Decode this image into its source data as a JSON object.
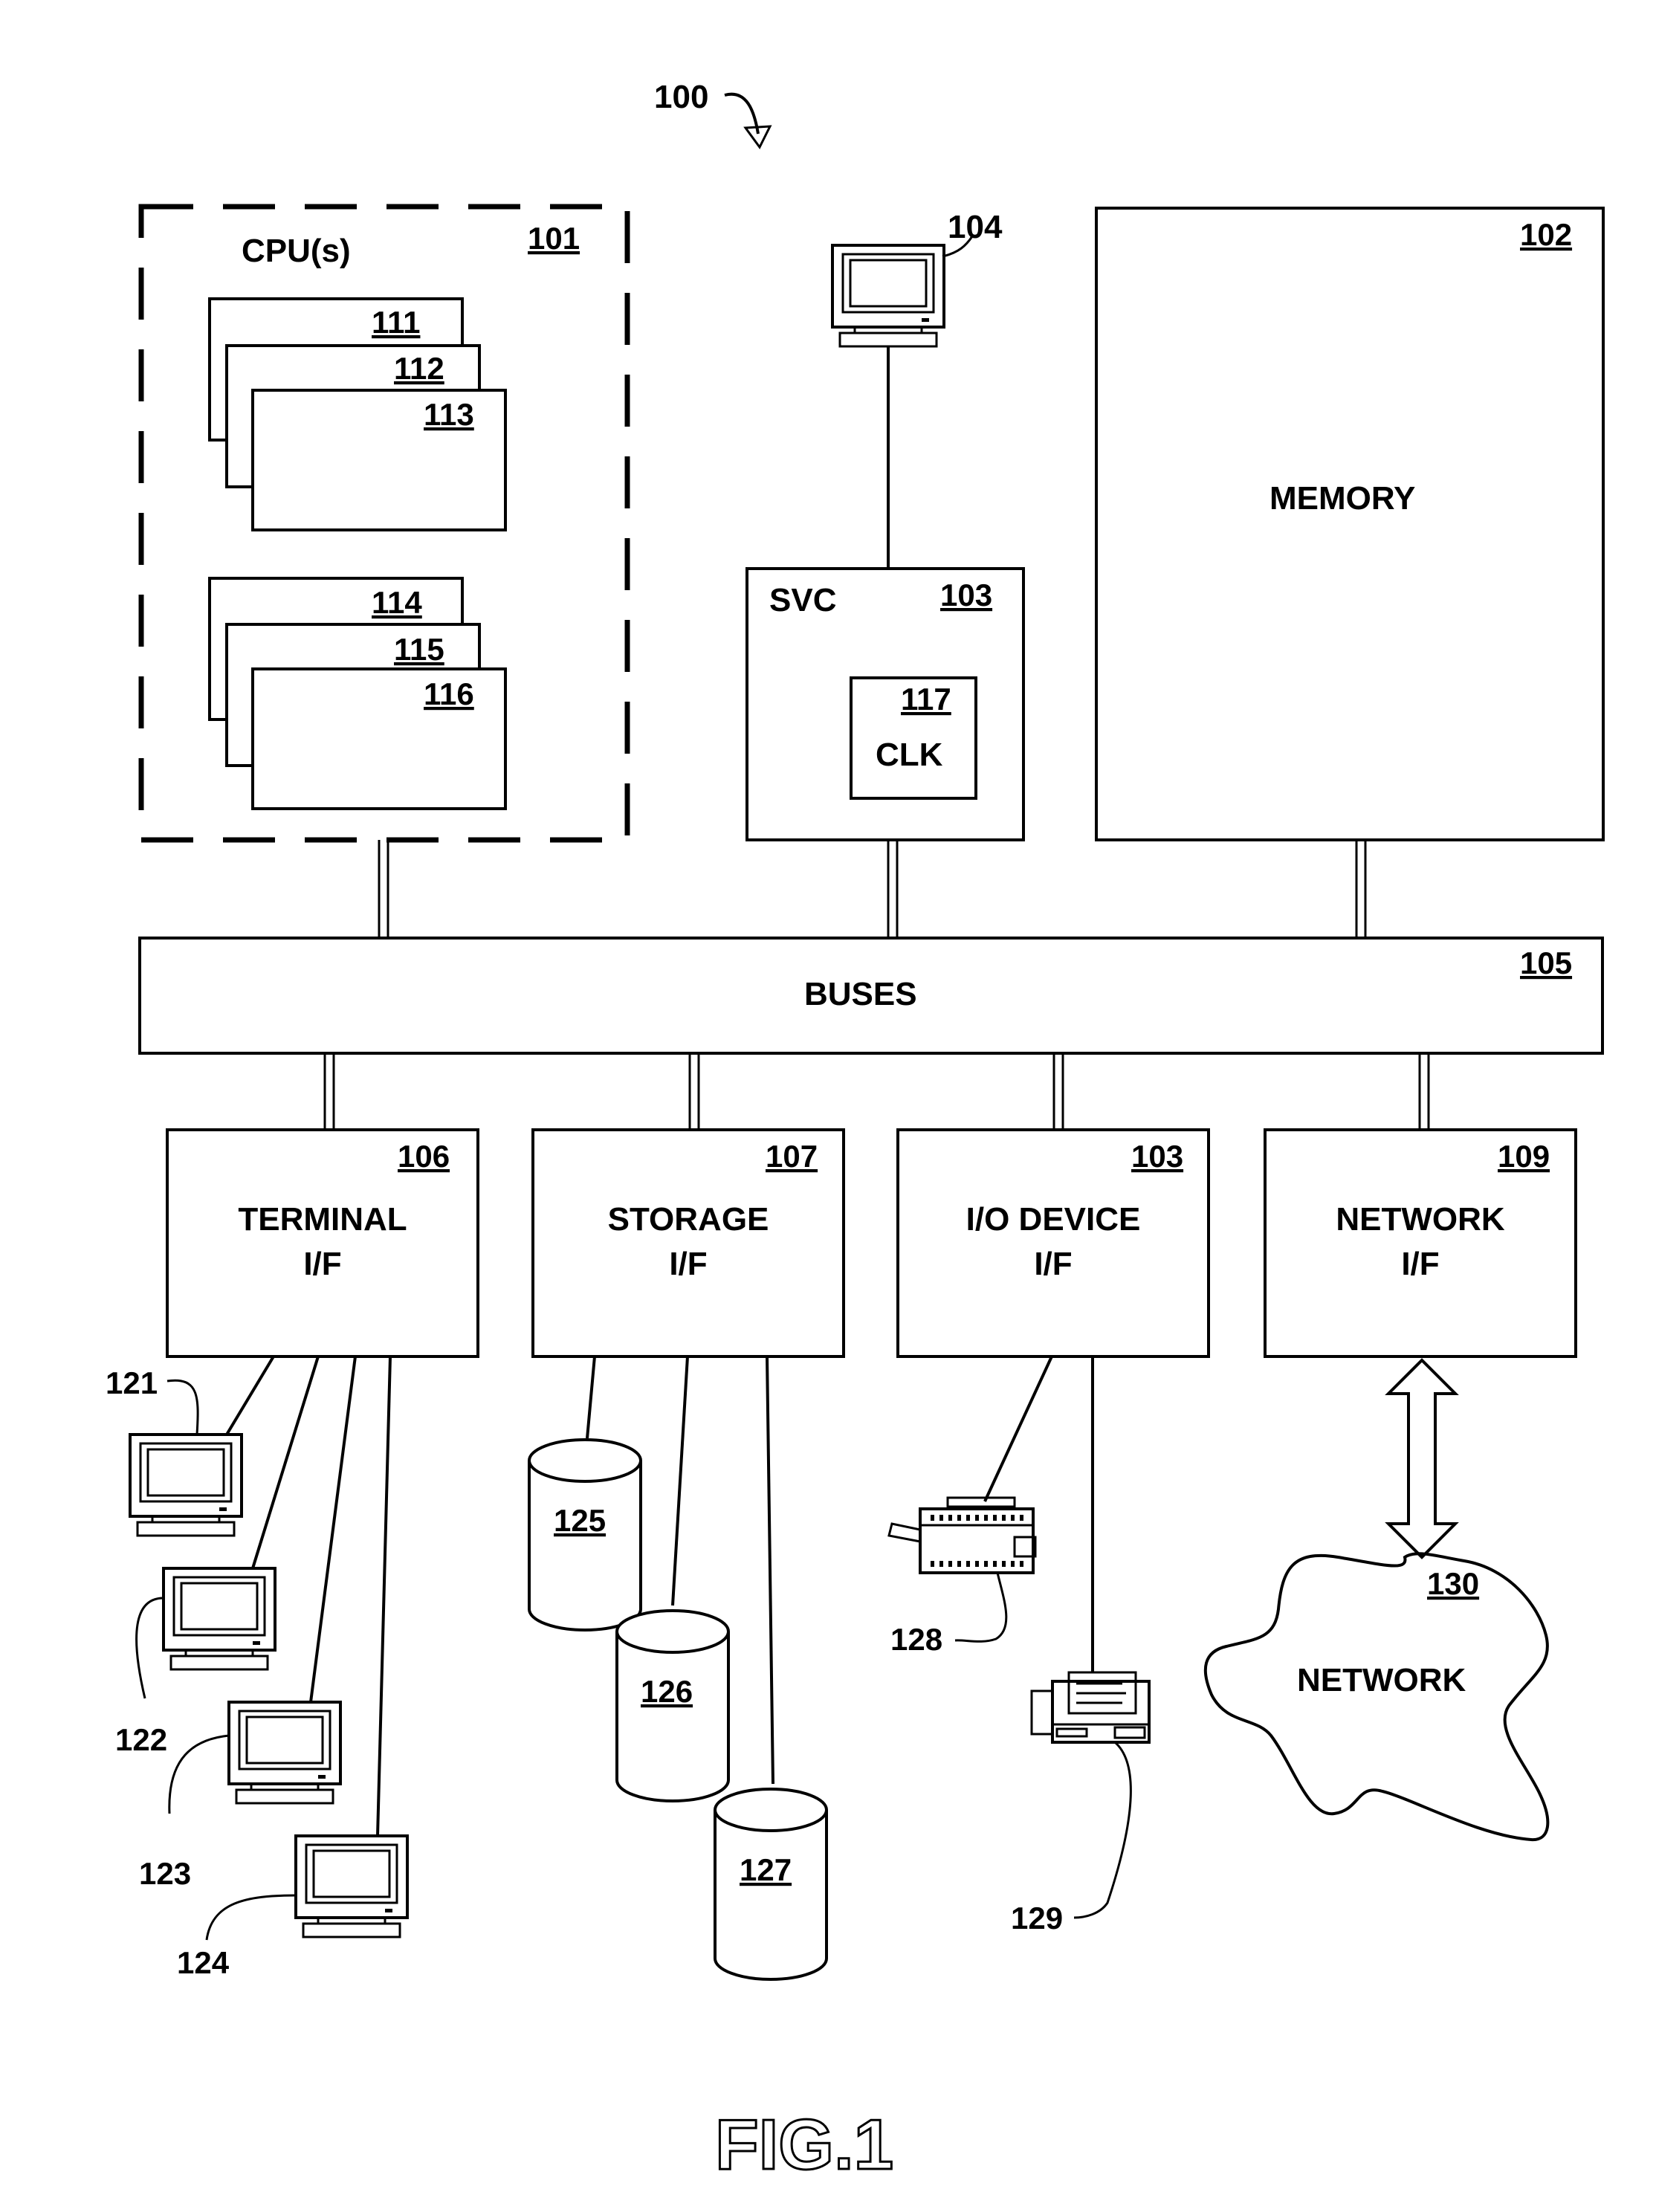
{
  "figure": {
    "ref": "100",
    "caption": "FIG.1"
  },
  "cpu": {
    "title": "CPU(s)",
    "ref": "101",
    "processors_group_a": [
      "111",
      "112",
      "113"
    ],
    "processors_group_b": [
      "114",
      "115",
      "116"
    ]
  },
  "console": {
    "ref": "104"
  },
  "svc": {
    "title": "SVC",
    "ref": "103",
    "clock": {
      "ref": "117",
      "title": "CLK"
    }
  },
  "memory": {
    "title": "MEMORY",
    "ref": "102"
  },
  "buses": {
    "title": "BUSES",
    "ref": "105"
  },
  "interfaces": [
    {
      "ref": "106",
      "line1": "TERMINAL",
      "line2": "I/F"
    },
    {
      "ref": "107",
      "line1": "STORAGE",
      "line2": "I/F"
    },
    {
      "ref": "103",
      "line1": "I/O DEVICE",
      "line2": "I/F"
    },
    {
      "ref": "109",
      "line1": "NETWORK",
      "line2": "I/F"
    }
  ],
  "terminals": [
    "121",
    "122",
    "123",
    "124"
  ],
  "storage_devices": [
    "125",
    "126",
    "127"
  ],
  "printer": {
    "ref": "128"
  },
  "fax": {
    "ref": "129"
  },
  "network": {
    "ref": "130",
    "title": "NETWORK"
  }
}
